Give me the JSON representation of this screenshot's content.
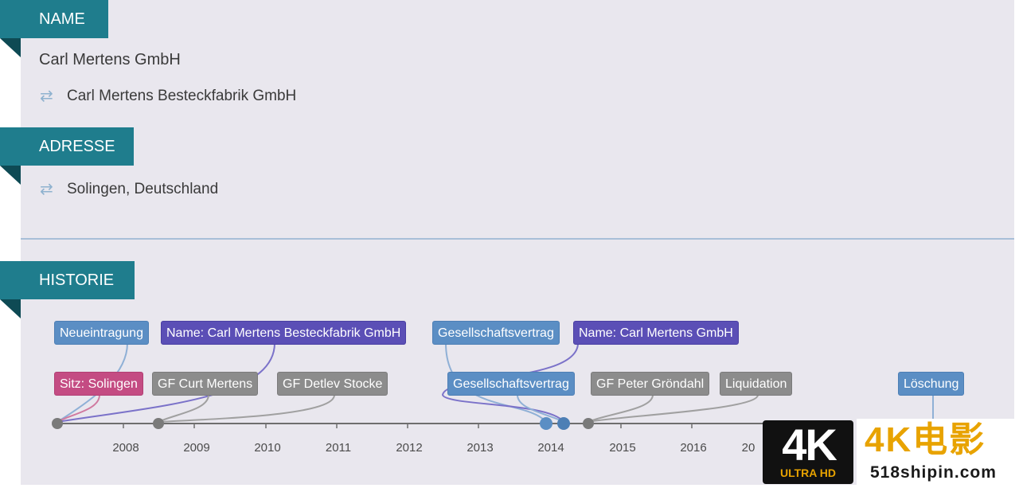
{
  "sections": {
    "name": {
      "title": "NAME",
      "current": "Carl Mertens GmbH",
      "aliases": [
        "Carl Mertens Besteckfabrik GmbH"
      ]
    },
    "address": {
      "title": "ADRESSE",
      "aliases": [
        "Solingen, Deutschland"
      ]
    },
    "history": {
      "title": "HISTORIE"
    }
  },
  "timeline": {
    "years": [
      "2008",
      "2009",
      "2010",
      "2011",
      "2012",
      "2013",
      "2014",
      "2015",
      "2016",
      "20"
    ],
    "events_row1": [
      {
        "label": "Neueintragung",
        "kind": "blue"
      },
      {
        "label": "Name: Carl Mertens Besteckfabrik GmbH",
        "kind": "purple"
      },
      {
        "label": "Gesellschaftsvertrag",
        "kind": "blue"
      },
      {
        "label": "Name: Carl Mertens GmbH",
        "kind": "purple"
      }
    ],
    "events_row2": [
      {
        "label": "Sitz: Solingen",
        "kind": "magenta"
      },
      {
        "label": "GF Curt Mertens",
        "kind": "gray"
      },
      {
        "label": "GF Detlev Stocke",
        "kind": "gray"
      },
      {
        "label": "Gesellschaftsvertrag",
        "kind": "blue"
      },
      {
        "label": "GF Peter Gröndahl",
        "kind": "gray"
      },
      {
        "label": "Liquidation",
        "kind": "gray"
      },
      {
        "label": "Löschung",
        "kind": "blue"
      }
    ],
    "colors": {
      "blue": "#5b8ec4",
      "purple": "#5b4fb6",
      "magenta": "#c44c83",
      "gray": "#8c8c8c",
      "axis": "#6e6e6e"
    }
  },
  "icons": {
    "alias_icon": "swap-arrows-icon"
  },
  "watermark": {
    "badge": "4K",
    "badge_sub": "ULTRA HD",
    "brand": "4K电影",
    "url": "518shipin.com"
  }
}
